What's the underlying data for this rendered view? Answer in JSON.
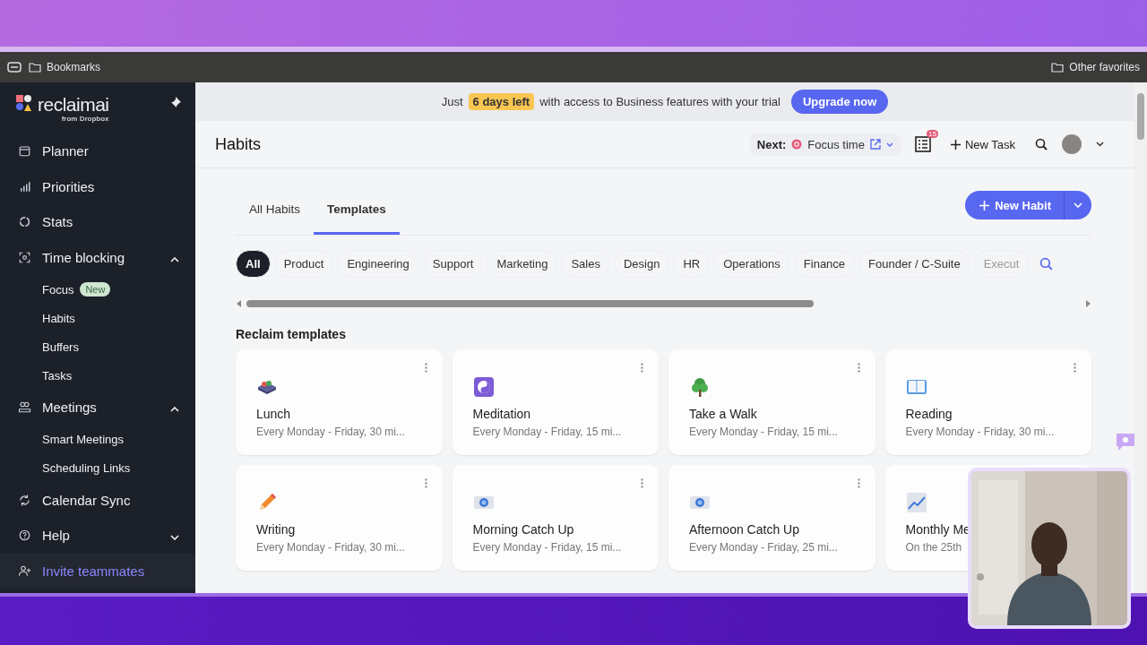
{
  "browser": {
    "bookmarks": "Bookmarks",
    "other_favorites": "Other favorites"
  },
  "sidebar": {
    "logo": "reclaimai",
    "logo_sub": "from Dropbox",
    "items": [
      {
        "label": "Planner"
      },
      {
        "label": "Priorities"
      },
      {
        "label": "Stats"
      },
      {
        "label": "Time blocking",
        "expanded": true,
        "children": [
          {
            "label": "Focus",
            "badge": "New"
          },
          {
            "label": "Habits"
          },
          {
            "label": "Buffers"
          },
          {
            "label": "Tasks"
          }
        ]
      },
      {
        "label": "Meetings",
        "expanded": true,
        "children": [
          {
            "label": "Smart Meetings"
          },
          {
            "label": "Scheduling Links"
          }
        ]
      },
      {
        "label": "Calendar Sync"
      },
      {
        "label": "Help",
        "expanded": false
      },
      {
        "label": "Invite teammates",
        "kind": "invite"
      }
    ]
  },
  "banner": {
    "before": "Just",
    "highlight": "6 days left",
    "after": "with access to Business features with your trial",
    "button": "Upgrade now"
  },
  "header": {
    "title": "Habits",
    "next_label": "Next:",
    "next_event": "Focus time",
    "tasks_count": "15",
    "new_task": "New Task"
  },
  "tabs": [
    {
      "label": "All Habits",
      "selected": false
    },
    {
      "label": "Templates",
      "selected": true
    }
  ],
  "new_habit": "New Habit",
  "filters": [
    {
      "label": "All",
      "selected": true
    },
    {
      "label": "Product",
      "selected": false
    },
    {
      "label": "Engineering",
      "selected": false
    },
    {
      "label": "Support",
      "selected": false
    },
    {
      "label": "Marketing",
      "selected": false
    },
    {
      "label": "Sales",
      "selected": false
    },
    {
      "label": "Design",
      "selected": false
    },
    {
      "label": "HR",
      "selected": false
    },
    {
      "label": "Operations",
      "selected": false
    },
    {
      "label": "Finance",
      "selected": false
    },
    {
      "label": "Founder / C-Suite",
      "selected": false
    },
    {
      "label": "Execut",
      "selected": false
    }
  ],
  "section_title": "Reclaim templates",
  "cards": [
    {
      "title": "Lunch",
      "subtitle": "Every Monday - Friday, 30 mi..."
    },
    {
      "title": "Meditation",
      "subtitle": "Every Monday - Friday, 15 mi..."
    },
    {
      "title": "Take a Walk",
      "subtitle": "Every Monday - Friday, 15 mi..."
    },
    {
      "title": "Reading",
      "subtitle": "Every Monday - Friday, 30 mi..."
    },
    {
      "title": "Writing",
      "subtitle": "Every Monday - Friday, 30 mi..."
    },
    {
      "title": "Morning Catch Up",
      "subtitle": "Every Monday - Friday, 15 mi..."
    },
    {
      "title": "Afternoon Catch Up",
      "subtitle": "Every Monday - Friday, 25 mi..."
    },
    {
      "title": "Monthly Me",
      "subtitle": "On the 25th"
    }
  ]
}
